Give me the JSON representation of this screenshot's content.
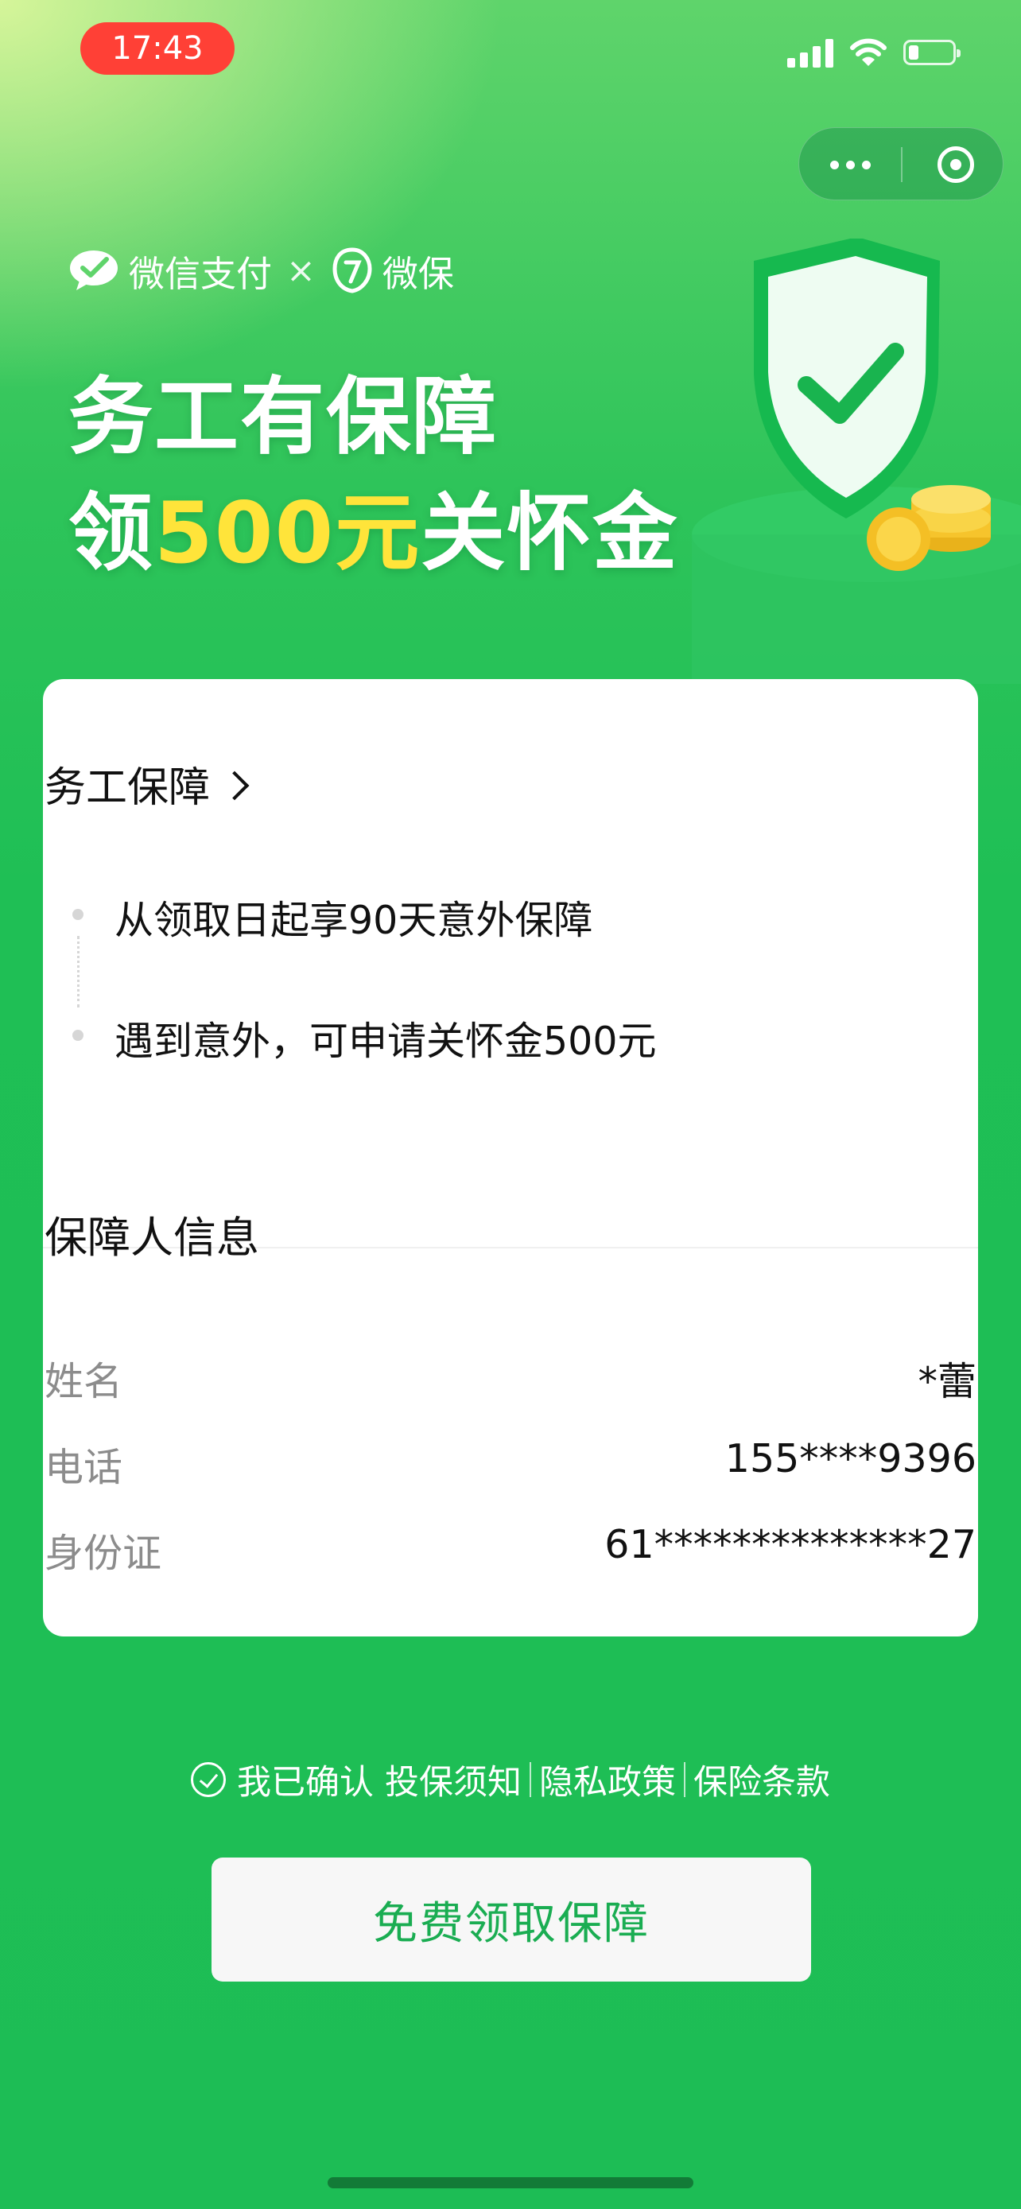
{
  "status_bar": {
    "time": "17:43",
    "battery_level": 0.2
  },
  "capsule": {
    "more_icon": "more-dots-icon",
    "close_icon": "target-circle-icon"
  },
  "brand": {
    "wechat_pay": "微信支付",
    "separator": "×",
    "weibao": "微保"
  },
  "hero": {
    "line1": "务工有保障",
    "line2_prefix": "领",
    "line2_accent": "500元",
    "line2_suffix": "关怀金",
    "accent_color": "#ffe43a"
  },
  "coverage": {
    "title": "务工保障",
    "points": [
      "从领取日起享90天意外保障",
      "遇到意外，可申请关怀金500元"
    ]
  },
  "insured": {
    "title": "保障人信息",
    "rows": [
      {
        "label": "姓名",
        "value": "*蕾"
      },
      {
        "label": "电话",
        "value": "155****9396"
      },
      {
        "label": "身份证",
        "value": "61**************27"
      }
    ]
  },
  "agreement": {
    "confirm": "我已确认",
    "notice": "投保须知",
    "privacy": "隐私政策",
    "terms": "保险条款"
  },
  "cta": {
    "label": "免费领取保障",
    "color": "#1aad52"
  },
  "colors": {
    "primary_green": "#1dbd55",
    "status_pill": "#ff4036"
  }
}
